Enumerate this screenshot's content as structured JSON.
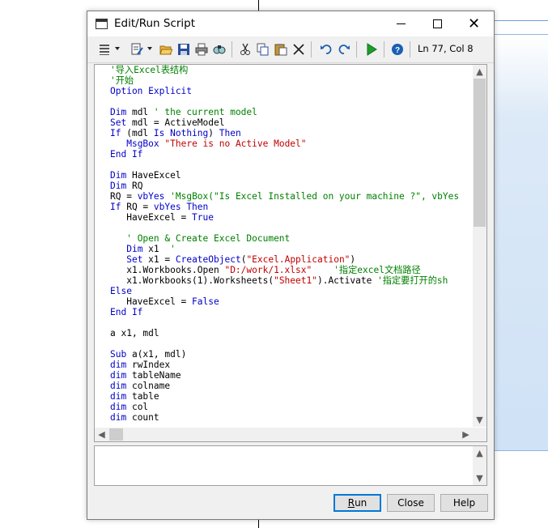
{
  "window": {
    "title": "Edit/Run Script",
    "minimize_icon": "minimize-icon",
    "maximize_icon": "maximize-icon",
    "close_glyph": "✕"
  },
  "toolbar": {
    "icons": [
      "editor-menu-icon",
      "dropdown-arrow-icon",
      "edit-menu-icon",
      "dropdown-arrow-icon",
      "open-file-icon",
      "save-icon",
      "print-icon",
      "find-icon",
      "cut-icon",
      "copy-icon",
      "paste-icon",
      "delete-icon",
      "undo-icon",
      "redo-icon",
      "run-icon",
      "help-icon"
    ],
    "position": "Ln 77, Col 8"
  },
  "code_lines": [
    [
      [
        "c",
        "'导入Excel表结构"
      ]
    ],
    [
      [
        "c",
        "'开始"
      ]
    ],
    [
      [
        "k",
        "Option Explicit"
      ]
    ],
    [
      [
        "t",
        ""
      ]
    ],
    [
      [
        "k",
        "Dim"
      ],
      [
        "t",
        " mdl "
      ],
      [
        "c",
        "' the current model"
      ]
    ],
    [
      [
        "k",
        "Set"
      ],
      [
        "t",
        " mdl = ActiveModel"
      ]
    ],
    [
      [
        "k",
        "If"
      ],
      [
        "t",
        " (mdl "
      ],
      [
        "k",
        "Is Nothing"
      ],
      [
        "t",
        ") "
      ],
      [
        "k",
        "Then"
      ]
    ],
    [
      [
        "t",
        "   "
      ],
      [
        "k",
        "MsgBox"
      ],
      [
        "t",
        " "
      ],
      [
        "s",
        "\"There is no Active Model\""
      ]
    ],
    [
      [
        "k",
        "End If"
      ]
    ],
    [
      [
        "t",
        ""
      ]
    ],
    [
      [
        "k",
        "Dim"
      ],
      [
        "t",
        " HaveExcel"
      ]
    ],
    [
      [
        "k",
        "Dim"
      ],
      [
        "t",
        " RQ"
      ]
    ],
    [
      [
        "t",
        "RQ = "
      ],
      [
        "k",
        "vbYes"
      ],
      [
        "t",
        " "
      ],
      [
        "c",
        "'MsgBox(\"Is Excel Installed on your machine ?\", vbYes"
      ]
    ],
    [
      [
        "k",
        "If"
      ],
      [
        "t",
        " RQ = "
      ],
      [
        "k",
        "vbYes Then"
      ]
    ],
    [
      [
        "t",
        "   HaveExcel = "
      ],
      [
        "k",
        "True"
      ]
    ],
    [
      [
        "t",
        ""
      ]
    ],
    [
      [
        "t",
        "   "
      ],
      [
        "c",
        "' Open & Create Excel Document"
      ]
    ],
    [
      [
        "t",
        "   "
      ],
      [
        "k",
        "Dim"
      ],
      [
        "t",
        " x1  "
      ],
      [
        "c",
        "'"
      ]
    ],
    [
      [
        "t",
        "   "
      ],
      [
        "k",
        "Set"
      ],
      [
        "t",
        " x1 = "
      ],
      [
        "k",
        "CreateObject"
      ],
      [
        "t",
        "("
      ],
      [
        "s",
        "\"Excel.Application\""
      ],
      [
        "t",
        ")"
      ]
    ],
    [
      [
        "t",
        "   x1.Workbooks.Open "
      ],
      [
        "s",
        "\"D:/work/1.xlsx\""
      ],
      [
        "t",
        "    "
      ],
      [
        "c",
        "'指定excel文档路径"
      ]
    ],
    [
      [
        "t",
        "   x1.Workbooks(1).Worksheets("
      ],
      [
        "s",
        "\"Sheet1\""
      ],
      [
        "t",
        ").Activate "
      ],
      [
        "c",
        "'指定要打开的sh"
      ]
    ],
    [
      [
        "k",
        "Else"
      ]
    ],
    [
      [
        "t",
        "   HaveExcel = "
      ],
      [
        "k",
        "False"
      ]
    ],
    [
      [
        "k",
        "End If"
      ]
    ],
    [
      [
        "t",
        ""
      ]
    ],
    [
      [
        "t",
        "a x1, mdl"
      ]
    ],
    [
      [
        "t",
        ""
      ]
    ],
    [
      [
        "k",
        "Sub"
      ],
      [
        "t",
        " a(x1, mdl)"
      ]
    ],
    [
      [
        "k",
        "dim"
      ],
      [
        "t",
        " rwIndex"
      ]
    ],
    [
      [
        "k",
        "dim"
      ],
      [
        "t",
        " tableName"
      ]
    ],
    [
      [
        "k",
        "dim"
      ],
      [
        "t",
        " colname"
      ]
    ],
    [
      [
        "k",
        "dim"
      ],
      [
        "t",
        " table"
      ]
    ],
    [
      [
        "k",
        "dim"
      ],
      [
        "t",
        " col"
      ]
    ],
    [
      [
        "k",
        "dim"
      ],
      [
        "t",
        " count"
      ]
    ]
  ],
  "scroll": {
    "up": "▲",
    "down": "▼",
    "left": "◀",
    "right": "▶"
  },
  "buttons": {
    "run_prefix": "",
    "run_hotkey": "R",
    "run_rest": "un",
    "close": "Close",
    "help": "Help"
  }
}
